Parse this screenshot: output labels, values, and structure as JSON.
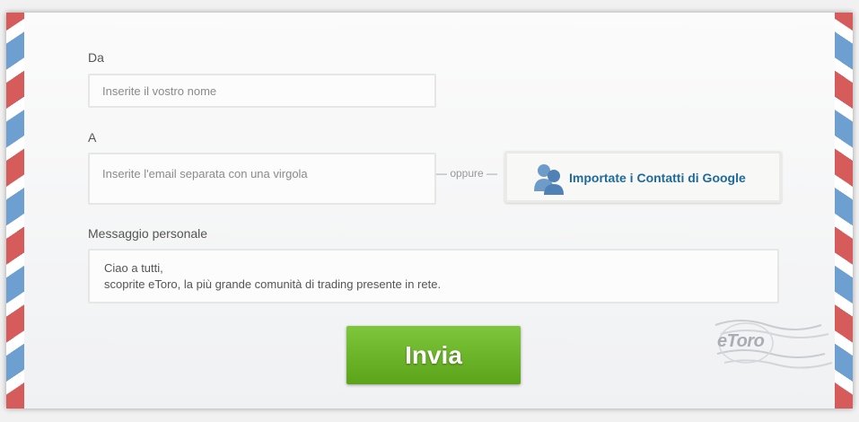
{
  "form": {
    "from_label": "Da",
    "from_placeholder": "Inserite il vostro nome",
    "to_label": "A",
    "to_placeholder": "Inserite l'email separata con una virgola",
    "or_text": "— oppure —",
    "google_import_label": "Importate i Contatti di Google",
    "message_label": "Messaggio personale",
    "message_lines": [
      "Ciao a tutti,",
      "scoprite eToro, la più grande comunità di trading presente in rete."
    ],
    "submit_label": "Invia"
  },
  "stamp": {
    "brand": "eToro"
  },
  "icons": {
    "contacts": "contacts-icon",
    "postmark": "postmark-icon"
  },
  "colors": {
    "stripe_red": "#d65b5b",
    "stripe_blue": "#6d9fd0",
    "button_green": "#6ab52a",
    "link_blue": "#1f6a9c"
  }
}
